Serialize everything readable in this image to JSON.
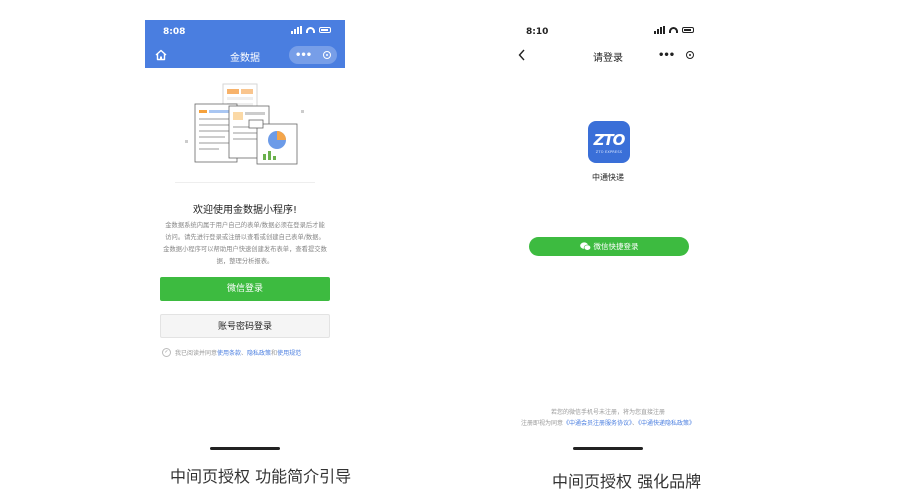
{
  "left": {
    "time": "8:08",
    "nav_title": "金数据",
    "capsule_dots": "•••",
    "welcome": "欢迎使用金数据小程序!",
    "description": "金数据系统内属于用户自己的表单/数据必须在登录后才能访问。请先进行登录或注册以查看或创建自己表单/数据。金数据小程序可以帮助用户快速创建发布表单，查看提交数据，整理分析报表。",
    "btn_wechat": "微信登录",
    "btn_account": "账号密码登录",
    "agree_prefix": "我已阅读并同意",
    "agree_link1": "使用条款",
    "agree_sep1": "、",
    "agree_link2": "隐私政策",
    "agree_sep2": "和",
    "agree_link3": "使用规范"
  },
  "right": {
    "time": "8:10",
    "nav_title": "请登录",
    "capsule_dots": "•••",
    "logo_text": "ZTO",
    "logo_sub": "ZTO EXPRESS",
    "brand_name": "中通快递",
    "btn_wechat": "微信快捷登录",
    "foot_line1": "若您的微信手机号未注册，将为您直接注册",
    "foot_prefix": "注册即视为同意",
    "foot_link1": "《中通会员注册服务协议》",
    "foot_sep": "、",
    "foot_link2": "《中通快递隐私政策》"
  },
  "captions": {
    "left": "中间页授权 功能简介引导",
    "right": "中间页授权 强化品牌"
  },
  "colors": {
    "header_blue": "#4a7ee0",
    "wechat_green": "#3dbb40",
    "zto_blue": "#3a6fd8"
  }
}
